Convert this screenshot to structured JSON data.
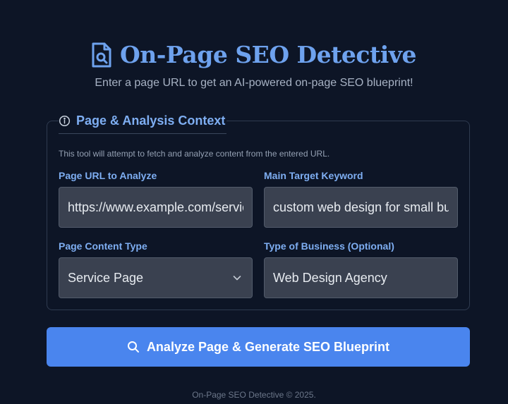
{
  "app": {
    "title": "On-Page SEO Detective",
    "subtitle": "Enter a page URL to get an AI-powered on-page SEO blueprint!",
    "header_icon": "document-search-icon"
  },
  "context": {
    "legend": "Page & Analysis Context",
    "legend_icon": "info-icon",
    "note": "This tool will attempt to fetch and analyze content from the entered URL."
  },
  "form": {
    "page_url": {
      "label": "Page URL to Analyze",
      "value": "https://www.example.com/services"
    },
    "keyword": {
      "label": "Main Target Keyword",
      "value": "custom web design for small business"
    },
    "content_type": {
      "label": "Page Content Type",
      "value": "Service Page"
    },
    "business_type": {
      "label": "Type of Business (Optional)",
      "value": "Web Design Agency"
    }
  },
  "actions": {
    "analyze_label": "Analyze Page & Generate SEO Blueprint",
    "analyze_icon": "search-icon"
  },
  "footer": {
    "text": "On-Page SEO Detective © 2025."
  },
  "colors": {
    "background": "#0d1526",
    "accent": "#6ea2ee",
    "button": "#4a85ee"
  }
}
